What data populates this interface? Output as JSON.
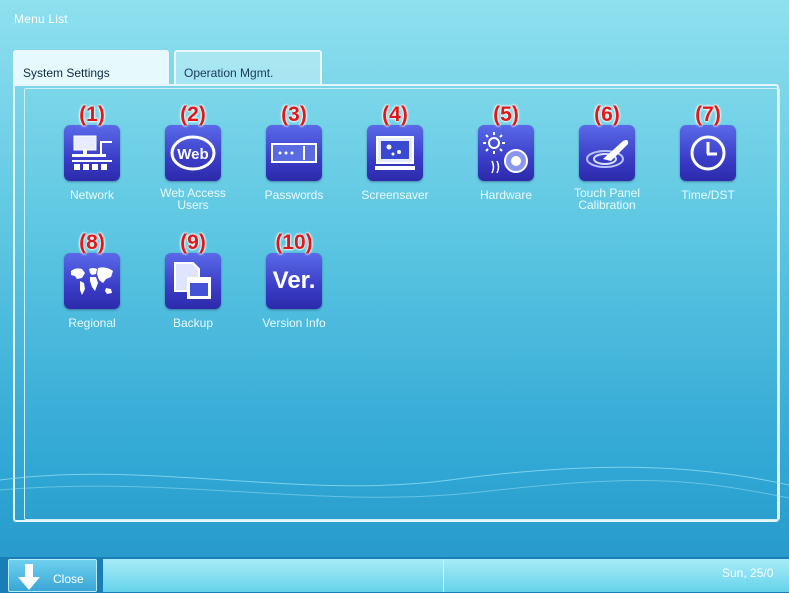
{
  "window": {
    "title": "Menu List"
  },
  "tabs": [
    {
      "label": "System Settings",
      "active": true
    },
    {
      "label": "Operation Mgmt.",
      "active": false
    }
  ],
  "menu_items": [
    {
      "number": "(1)",
      "label": "Network",
      "icon": "network-icon"
    },
    {
      "number": "(2)",
      "label": "Web Access\nUsers",
      "icon": "web-icon"
    },
    {
      "number": "(3)",
      "label": "Passwords",
      "icon": "password-icon"
    },
    {
      "number": "(4)",
      "label": "Screensaver",
      "icon": "screensaver-icon"
    },
    {
      "number": "(5)",
      "label": "Hardware",
      "icon": "hardware-icon"
    },
    {
      "number": "(6)",
      "label": "Touch Panel\nCalibration",
      "icon": "touch-panel-icon"
    },
    {
      "number": "(7)",
      "label": "Time/DST",
      "icon": "clock-icon"
    },
    {
      "number": "(8)",
      "label": "Regional",
      "icon": "world-map-icon"
    },
    {
      "number": "(9)",
      "label": "Backup",
      "icon": "backup-icon"
    },
    {
      "number": "(10)",
      "label": "Version Info",
      "icon": "version-icon",
      "glyph": "Ver."
    }
  ],
  "footer": {
    "close_label": "Close",
    "date": "Sun, 25/0"
  }
}
